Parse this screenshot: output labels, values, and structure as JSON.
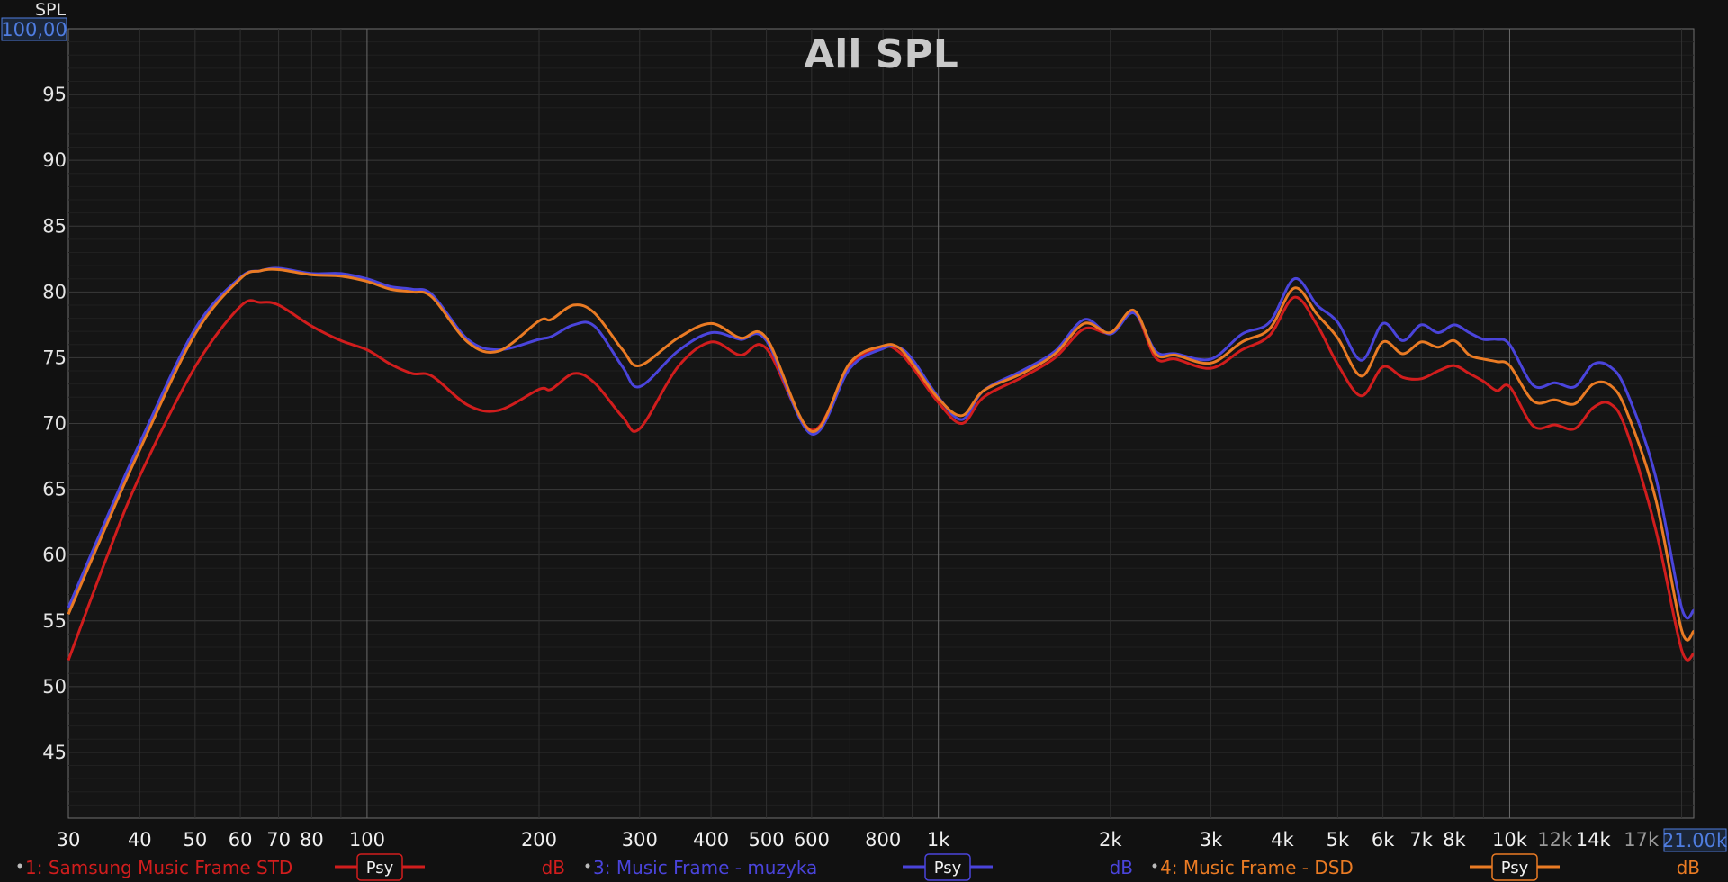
{
  "chart_data": {
    "type": "line",
    "title": "All SPL",
    "ylabel": "SPL",
    "ylim": [
      40,
      100
    ],
    "xlim": [
      30,
      21000
    ],
    "xscale": "log",
    "grid": true,
    "y_top_label": "100,00",
    "x_right_label": "21.00k",
    "y_ticks": [
      "95",
      "90",
      "85",
      "80",
      "75",
      "70",
      "65",
      "60",
      "55",
      "50",
      "45"
    ],
    "x_ticks": [
      {
        "f": 30,
        "label": "30"
      },
      {
        "f": 40,
        "label": "40"
      },
      {
        "f": 50,
        "label": "50"
      },
      {
        "f": 60,
        "label": "60"
      },
      {
        "f": 70,
        "label": "70"
      },
      {
        "f": 80,
        "label": "80"
      },
      {
        "f": 100,
        "label": "100"
      },
      {
        "f": 200,
        "label": "200"
      },
      {
        "f": 300,
        "label": "300"
      },
      {
        "f": 400,
        "label": "400"
      },
      {
        "f": 500,
        "label": "500"
      },
      {
        "f": 600,
        "label": "600"
      },
      {
        "f": 800,
        "label": "800"
      },
      {
        "f": 1000,
        "label": "1k"
      },
      {
        "f": 2000,
        "label": "2k"
      },
      {
        "f": 3000,
        "label": "3k"
      },
      {
        "f": 4000,
        "label": "4k"
      },
      {
        "f": 5000,
        "label": "5k"
      },
      {
        "f": 6000,
        "label": "6k"
      },
      {
        "f": 7000,
        "label": "7k"
      },
      {
        "f": 8000,
        "label": "8k"
      },
      {
        "f": 10000,
        "label": "10k"
      },
      {
        "f": 12000,
        "label": "12k",
        "dim": true
      },
      {
        "f": 14000,
        "label": "14k"
      },
      {
        "f": 17000,
        "label": "17k",
        "dim": true
      }
    ],
    "x": [
      30,
      35,
      40,
      50,
      60,
      65,
      70,
      80,
      90,
      100,
      110,
      120,
      130,
      150,
      170,
      200,
      210,
      230,
      250,
      280,
      300,
      350,
      400,
      450,
      500,
      600,
      700,
      800,
      850,
      900,
      1000,
      1100,
      1200,
      1400,
      1600,
      1800,
      2000,
      2200,
      2400,
      2600,
      3000,
      3400,
      3800,
      4200,
      4600,
      5000,
      5500,
      6000,
      6500,
      7000,
      7500,
      8000,
      8500,
      9000,
      9500,
      10000,
      11000,
      12000,
      13000,
      14000,
      15000,
      16000,
      18000,
      20000,
      21000
    ],
    "series": [
      {
        "name": "1: Samsung Music Frame STD",
        "color": "#d11d1d",
        "values": [
          52.0,
          59.8,
          66.0,
          74.3,
          78.9,
          79.2,
          79.0,
          77.4,
          76.3,
          75.6,
          74.5,
          73.8,
          73.6,
          71.4,
          71.0,
          72.6,
          72.6,
          73.8,
          73.1,
          70.5,
          69.6,
          74.3,
          76.2,
          75.2,
          75.7,
          69.5,
          74.4,
          75.8,
          75.5,
          74.3,
          71.6,
          70.0,
          72.0,
          73.5,
          75.0,
          77.2,
          76.9,
          78.5,
          75.0,
          74.9,
          74.2,
          75.6,
          76.7,
          79.6,
          77.5,
          74.5,
          72.1,
          74.3,
          73.5,
          73.4,
          74.0,
          74.4,
          73.8,
          73.2,
          72.5,
          72.8,
          69.8,
          69.9,
          69.6,
          71.2,
          71.5,
          69.5,
          62.0,
          52.8,
          52.5
        ]
      },
      {
        "name": "3: Music Frame - muzyka",
        "color": "#4a44db",
        "values": [
          56.0,
          62.8,
          68.5,
          77.2,
          81.1,
          81.6,
          81.8,
          81.4,
          81.4,
          81.0,
          80.4,
          80.2,
          79.8,
          76.4,
          75.6,
          76.4,
          76.6,
          77.5,
          77.4,
          74.3,
          72.8,
          75.5,
          76.9,
          76.4,
          76.3,
          69.2,
          74.2,
          75.7,
          75.8,
          74.9,
          72.0,
          70.3,
          72.5,
          74.0,
          75.5,
          77.9,
          76.8,
          78.4,
          75.5,
          75.3,
          74.9,
          76.8,
          77.7,
          81.0,
          79.0,
          77.7,
          74.8,
          77.6,
          76.3,
          77.5,
          76.9,
          77.5,
          76.9,
          76.4,
          76.4,
          76.0,
          72.9,
          73.1,
          72.8,
          74.5,
          74.3,
          72.5,
          66.0,
          56.0,
          55.8
        ]
      },
      {
        "name": "4: Music Frame - DSD",
        "color": "#ea7b24",
        "values": [
          55.5,
          62.3,
          68.0,
          76.8,
          81.0,
          81.6,
          81.7,
          81.3,
          81.2,
          80.8,
          80.2,
          80.0,
          79.6,
          76.2,
          75.5,
          77.8,
          77.9,
          79.0,
          78.4,
          75.6,
          74.4,
          76.5,
          77.6,
          76.5,
          76.5,
          69.4,
          74.6,
          75.9,
          75.8,
          74.6,
          71.9,
          70.6,
          72.5,
          73.8,
          75.3,
          77.6,
          76.9,
          78.6,
          75.3,
          75.2,
          74.6,
          76.2,
          77.2,
          80.3,
          78.3,
          76.5,
          73.6,
          76.2,
          75.3,
          76.2,
          75.8,
          76.3,
          75.2,
          74.9,
          74.7,
          74.4,
          71.7,
          71.8,
          71.5,
          73.0,
          72.9,
          71.0,
          64.3,
          54.3,
          54.2
        ]
      }
    ]
  },
  "legend": [
    {
      "label": "1: Samsung Music Frame STD",
      "color": "#d11d1d",
      "mode": "Psy",
      "unit": "dB"
    },
    {
      "label": "3: Music Frame - muzyka",
      "color": "#4a44db",
      "mode": "Psy",
      "unit": "dB"
    },
    {
      "label": "4: Music Frame - DSD",
      "color": "#ea7b24",
      "mode": "Psy",
      "unit": "dB"
    }
  ]
}
